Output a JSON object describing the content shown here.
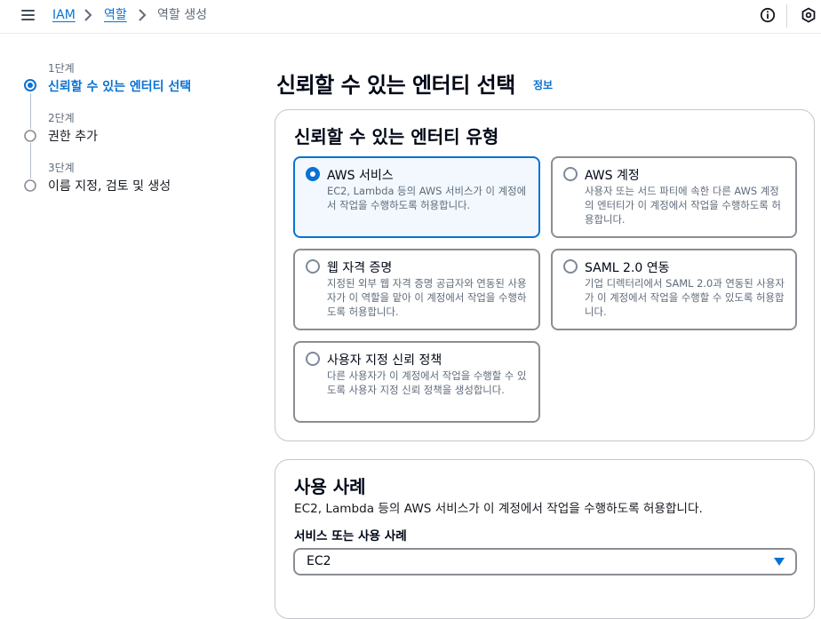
{
  "breadcrumb": {
    "items": [
      {
        "label": "IAM"
      },
      {
        "label": "역할"
      },
      {
        "label": "역할 생성"
      }
    ]
  },
  "steps": [
    {
      "step_label": "1단계",
      "title": "신뢰할 수 있는 엔터티 선택",
      "active": true
    },
    {
      "step_label": "2단계",
      "title": "권한 추가",
      "active": false
    },
    {
      "step_label": "3단계",
      "title": "이름 지정, 검토 및 생성",
      "active": false
    }
  ],
  "page": {
    "title": "신뢰할 수 있는 엔터티 선택",
    "info_link": "정보"
  },
  "entity_type": {
    "heading": "신뢰할 수 있는 엔터티 유형",
    "options": [
      {
        "title": "AWS 서비스",
        "description": "EC2, Lambda 등의 AWS 서비스가 이 계정에서 작업을 수행하도록 허용합니다.",
        "selected": true
      },
      {
        "title": "AWS 계정",
        "description": "사용자 또는 서드 파티에 속한 다른 AWS 계정의 엔터티가 이 계정에서 작업을 수행하도록 허용합니다.",
        "selected": false
      },
      {
        "title": "웹 자격 증명",
        "description": "지정된 외부 웹 자격 증명 공급자와 연동된 사용자가 이 역할을 맡아 이 계정에서 작업을 수행하도록 허용합니다.",
        "selected": false
      },
      {
        "title": "SAML 2.0 연동",
        "description": "기업 디렉터리에서 SAML 2.0과 연동된 사용자가 이 계정에서 작업을 수행할 수 있도록 허용합니다.",
        "selected": false
      },
      {
        "title": "사용자 지정 신뢰 정책",
        "description": "다른 사용자가 이 계정에서 작업을 수행할 수 있도록 사용자 지정 신뢰 정책을 생성합니다.",
        "selected": false
      }
    ]
  },
  "use_case": {
    "heading": "사용 사례",
    "description": "EC2, Lambda 등의 AWS 서비스가 이 계정에서 작업을 수행하도록 허용합니다.",
    "field_label": "서비스 또는 사용 사례",
    "select_value": "EC2"
  },
  "colors": {
    "accent": "#0972d3",
    "selected_bg": "#f2f8fd",
    "text": "#16191f",
    "muted": "#5f6b7a"
  }
}
